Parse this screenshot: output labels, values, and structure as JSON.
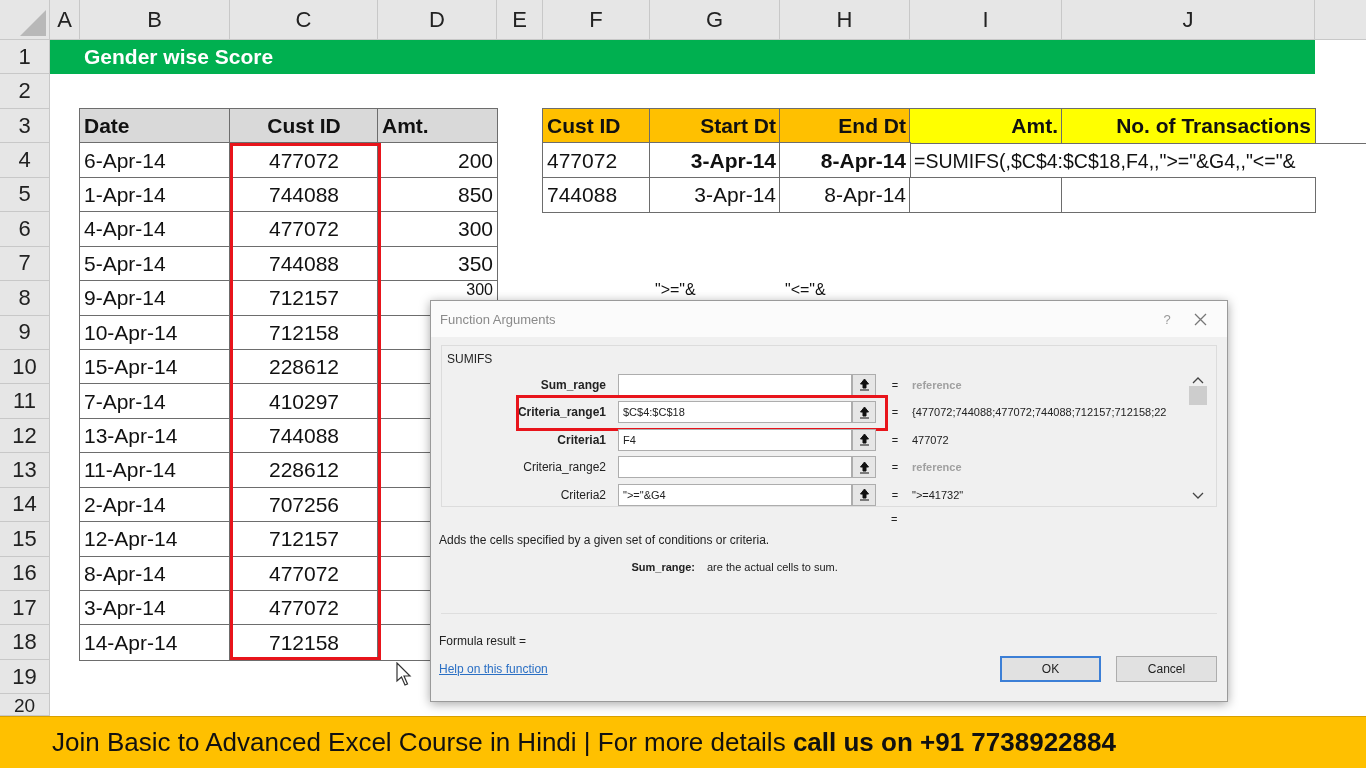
{
  "column_headers": [
    "A",
    "B",
    "C",
    "D",
    "E",
    "F",
    "G",
    "H",
    "I",
    "J"
  ],
  "row_headers": [
    "1",
    "2",
    "3",
    "4",
    "5",
    "6",
    "7",
    "8",
    "9",
    "10",
    "11",
    "12",
    "13",
    "14",
    "15",
    "16",
    "17",
    "18",
    "19",
    "20"
  ],
  "title_bar": {
    "text": "Gender wise Score"
  },
  "main_table": {
    "columns": [
      "Date",
      "Cust ID",
      "Amt."
    ],
    "rows": [
      {
        "date": "6-Apr-14",
        "cust_id": "477072",
        "amount": "200"
      },
      {
        "date": "1-Apr-14",
        "cust_id": "744088",
        "amount": "850"
      },
      {
        "date": "4-Apr-14",
        "cust_id": "477072",
        "amount": "300"
      },
      {
        "date": "5-Apr-14",
        "cust_id": "744088",
        "amount": "350"
      },
      {
        "date": "9-Apr-14",
        "cust_id": "712157",
        "amount": "300"
      },
      {
        "date": "10-Apr-14",
        "cust_id": "712158"
      },
      {
        "date": "15-Apr-14",
        "cust_id": "228612"
      },
      {
        "date": "7-Apr-14",
        "cust_id": "410297"
      },
      {
        "date": "13-Apr-14",
        "cust_id": "744088"
      },
      {
        "date": "11-Apr-14",
        "cust_id": "228612"
      },
      {
        "date": "2-Apr-14",
        "cust_id": "707256"
      },
      {
        "date": "12-Apr-14",
        "cust_id": "712157"
      },
      {
        "date": "8-Apr-14",
        "cust_id": "477072"
      },
      {
        "date": "3-Apr-14",
        "cust_id": "477072"
      },
      {
        "date": "14-Apr-14",
        "cust_id": "712158"
      }
    ]
  },
  "lookup_table": {
    "columns": [
      {
        "label": "Cust ID",
        "color": "#ffc000"
      },
      {
        "label": "Start Dt",
        "color": "#ffc000"
      },
      {
        "label": "End Dt",
        "color": "#ffc000"
      },
      {
        "label": "Amt.",
        "color": "#ffff00"
      },
      {
        "label": "No. of Transactions",
        "color": "#ffff00"
      }
    ],
    "rows": [
      {
        "cust_id": "477072",
        "start": "3-Apr-14",
        "end": "8-Apr-14",
        "dates_bold": true,
        "formula": "=SUMIFS(,$C$4:$C$18,F4,,\">=\"&G4,,\"<=\"&"
      },
      {
        "cust_id": "744088",
        "start": "3-Apr-14",
        "end": "8-Apr-14",
        "dates_bold": false
      }
    ]
  },
  "notes": [
    "\">=\"&",
    "\"<=\"&"
  ],
  "dialog": {
    "title": "Function Arguments",
    "help": "?",
    "function_name": "SUMIFS",
    "arguments": [
      {
        "label": "Sum_range",
        "required": true,
        "result": "reference",
        "result_muted": true,
        "highlighted": false
      },
      {
        "label": "Criteria_range1",
        "required": true,
        "value": "$C$4:$C$18",
        "result": "{477072;744088;477072;744088;712157;712158;22",
        "result_muted": false,
        "highlighted": true
      },
      {
        "label": "Criteria1",
        "required": true,
        "value": "F4",
        "result": "477072",
        "result_muted": false,
        "highlighted": false
      },
      {
        "label": "Criteria_range2",
        "required": false,
        "result": "reference",
        "result_muted": true,
        "highlighted": false
      },
      {
        "label": "Criteria2",
        "required": false,
        "value": "\">=\"&G4",
        "result": "\">=41732\"",
        "result_muted": false,
        "highlighted": false
      }
    ],
    "equals": [
      "=",
      "=",
      "=",
      "=",
      "=",
      "="
    ],
    "description": "Adds the cells specified by a given set of conditions or criteria.",
    "argument_help": {
      "name": "Sum_range:",
      "text": "are the actual cells to sum."
    },
    "formula_result": "Formula result =",
    "help_link": "Help on this function",
    "buttons": [
      {
        "label": "OK",
        "default": true
      },
      {
        "label": "Cancel",
        "default": false
      }
    ]
  },
  "banner": {
    "text": "Join Basic to Advanced Excel Course in Hindi | For more details **call us on +91 7738922884**"
  }
}
